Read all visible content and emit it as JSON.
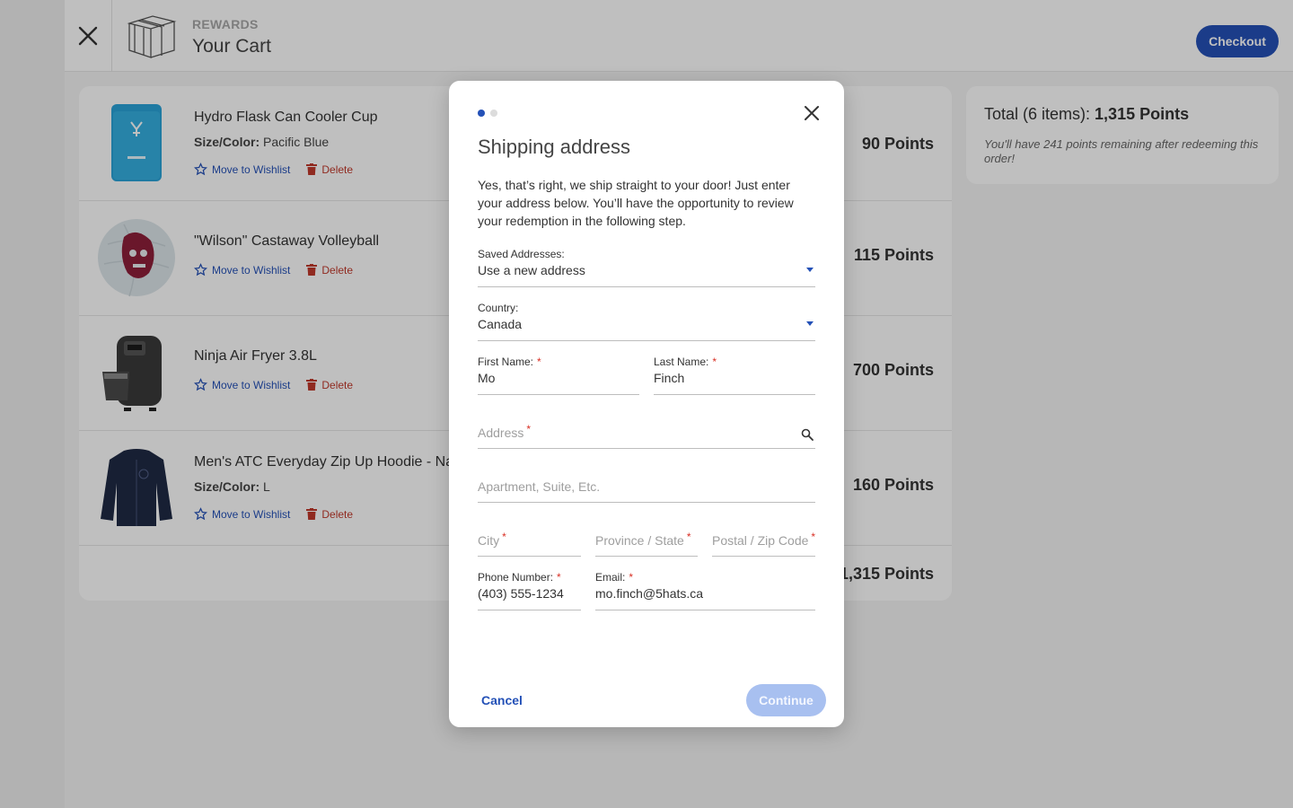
{
  "header": {
    "subtitle": "REWARDS",
    "title": "Your Cart",
    "checkout_label": "Checkout"
  },
  "cart": {
    "items": [
      {
        "name": "Hydro Flask Can Cooler Cup",
        "meta_label": "Size/Color:",
        "meta_value": "Pacific Blue",
        "wishlist_label": "Move to Wishlist",
        "delete_label": "Delete",
        "points": "90 Points"
      },
      {
        "name": "\"Wilson\" Castaway Volleyball",
        "meta_label": "",
        "meta_value": "",
        "wishlist_label": "Move to Wishlist",
        "delete_label": "Delete",
        "points": "115 Points"
      },
      {
        "name": "Ninja Air Fryer 3.8L",
        "meta_label": "",
        "meta_value": "",
        "wishlist_label": "Move to Wishlist",
        "delete_label": "Delete",
        "points": "700 Points"
      },
      {
        "name": "Men's ATC Everyday Zip Up Hoodie - Navy",
        "meta_label": "Size/Color:",
        "meta_value": "L",
        "wishlist_label": "Move to Wishlist",
        "delete_label": "Delete",
        "points": "160 Points"
      }
    ],
    "total_points": "1,315 Points"
  },
  "summary": {
    "title_prefix": "Total (6 items):",
    "title_value": "1,315 Points",
    "note": "You'll have 241 points remaining after redeeming this order!"
  },
  "modal": {
    "step_current": 1,
    "step_total": 2,
    "title": "Shipping address",
    "description": "Yes, that’s right, we ship straight to your door! Just enter your address below. You’ll have the opportunity to review your redemption in the following step.",
    "saved_addresses": {
      "label": "Saved Addresses:",
      "value": "Use a new address"
    },
    "country": {
      "label": "Country:",
      "value": "Canada"
    },
    "first_name": {
      "label": "First Name:",
      "value": "Mo"
    },
    "last_name": {
      "label": "Last Name:",
      "value": "Finch"
    },
    "address": {
      "placeholder": "Address"
    },
    "apartment": {
      "placeholder": "Apartment, Suite, Etc."
    },
    "city": {
      "placeholder": "City"
    },
    "province": {
      "placeholder": "Province / State"
    },
    "postal": {
      "placeholder": "Postal / Zip Code"
    },
    "phone": {
      "label": "Phone Number:",
      "value": "(403) 555-1234"
    },
    "email": {
      "label": "Email:",
      "value": "mo.finch@5hats.ca"
    },
    "required_marker": "*",
    "cancel_label": "Cancel",
    "continue_label": "Continue"
  },
  "colors": {
    "accent": "#2451b7",
    "danger": "#c0392b",
    "required": "#d93025",
    "continue_disabled": "#a8c0f0"
  }
}
